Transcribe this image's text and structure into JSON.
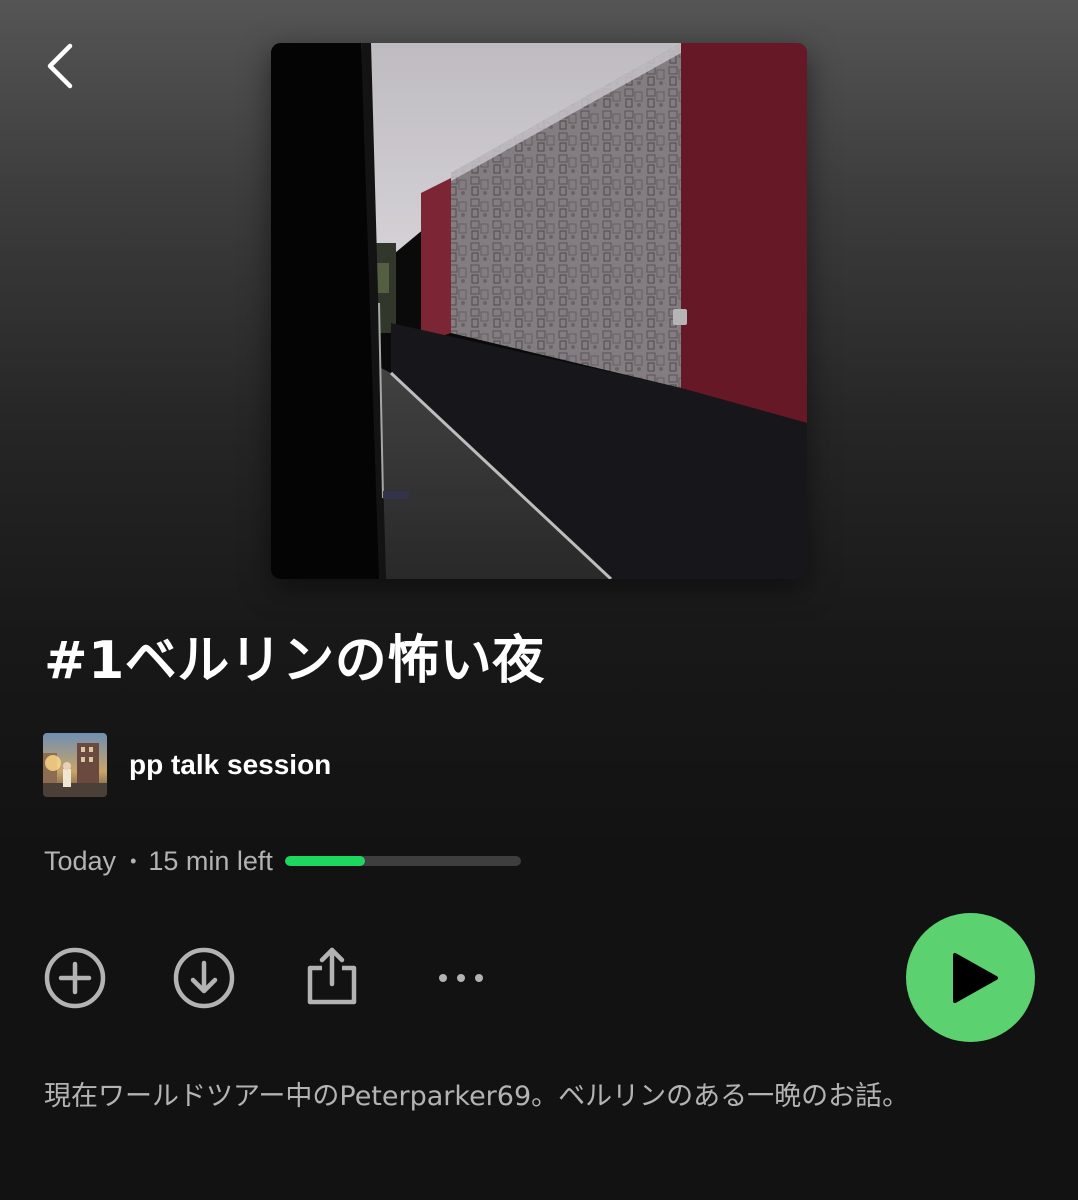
{
  "nav": {
    "back_icon": "chevron-left-icon"
  },
  "episode": {
    "title": "#1ベルリンの怖い夜",
    "show_name": "pp talk session",
    "date": "Today",
    "separator": "•",
    "time_left": "15 min left",
    "progress_fraction": 0.34,
    "description": "現在ワールドツアー中のPeterparker69。ベルリンのある一晩のお話。"
  },
  "actions": {
    "add_icon": "plus-circle-icon",
    "download_icon": "download-circle-icon",
    "share_icon": "share-icon",
    "more_icon": "more-horizontal-icon",
    "play_icon": "play-icon"
  },
  "colors": {
    "accent": "#1ed760",
    "play_button": "#5cd16f",
    "text_secondary": "#b3b3b3",
    "background": "#121212"
  }
}
